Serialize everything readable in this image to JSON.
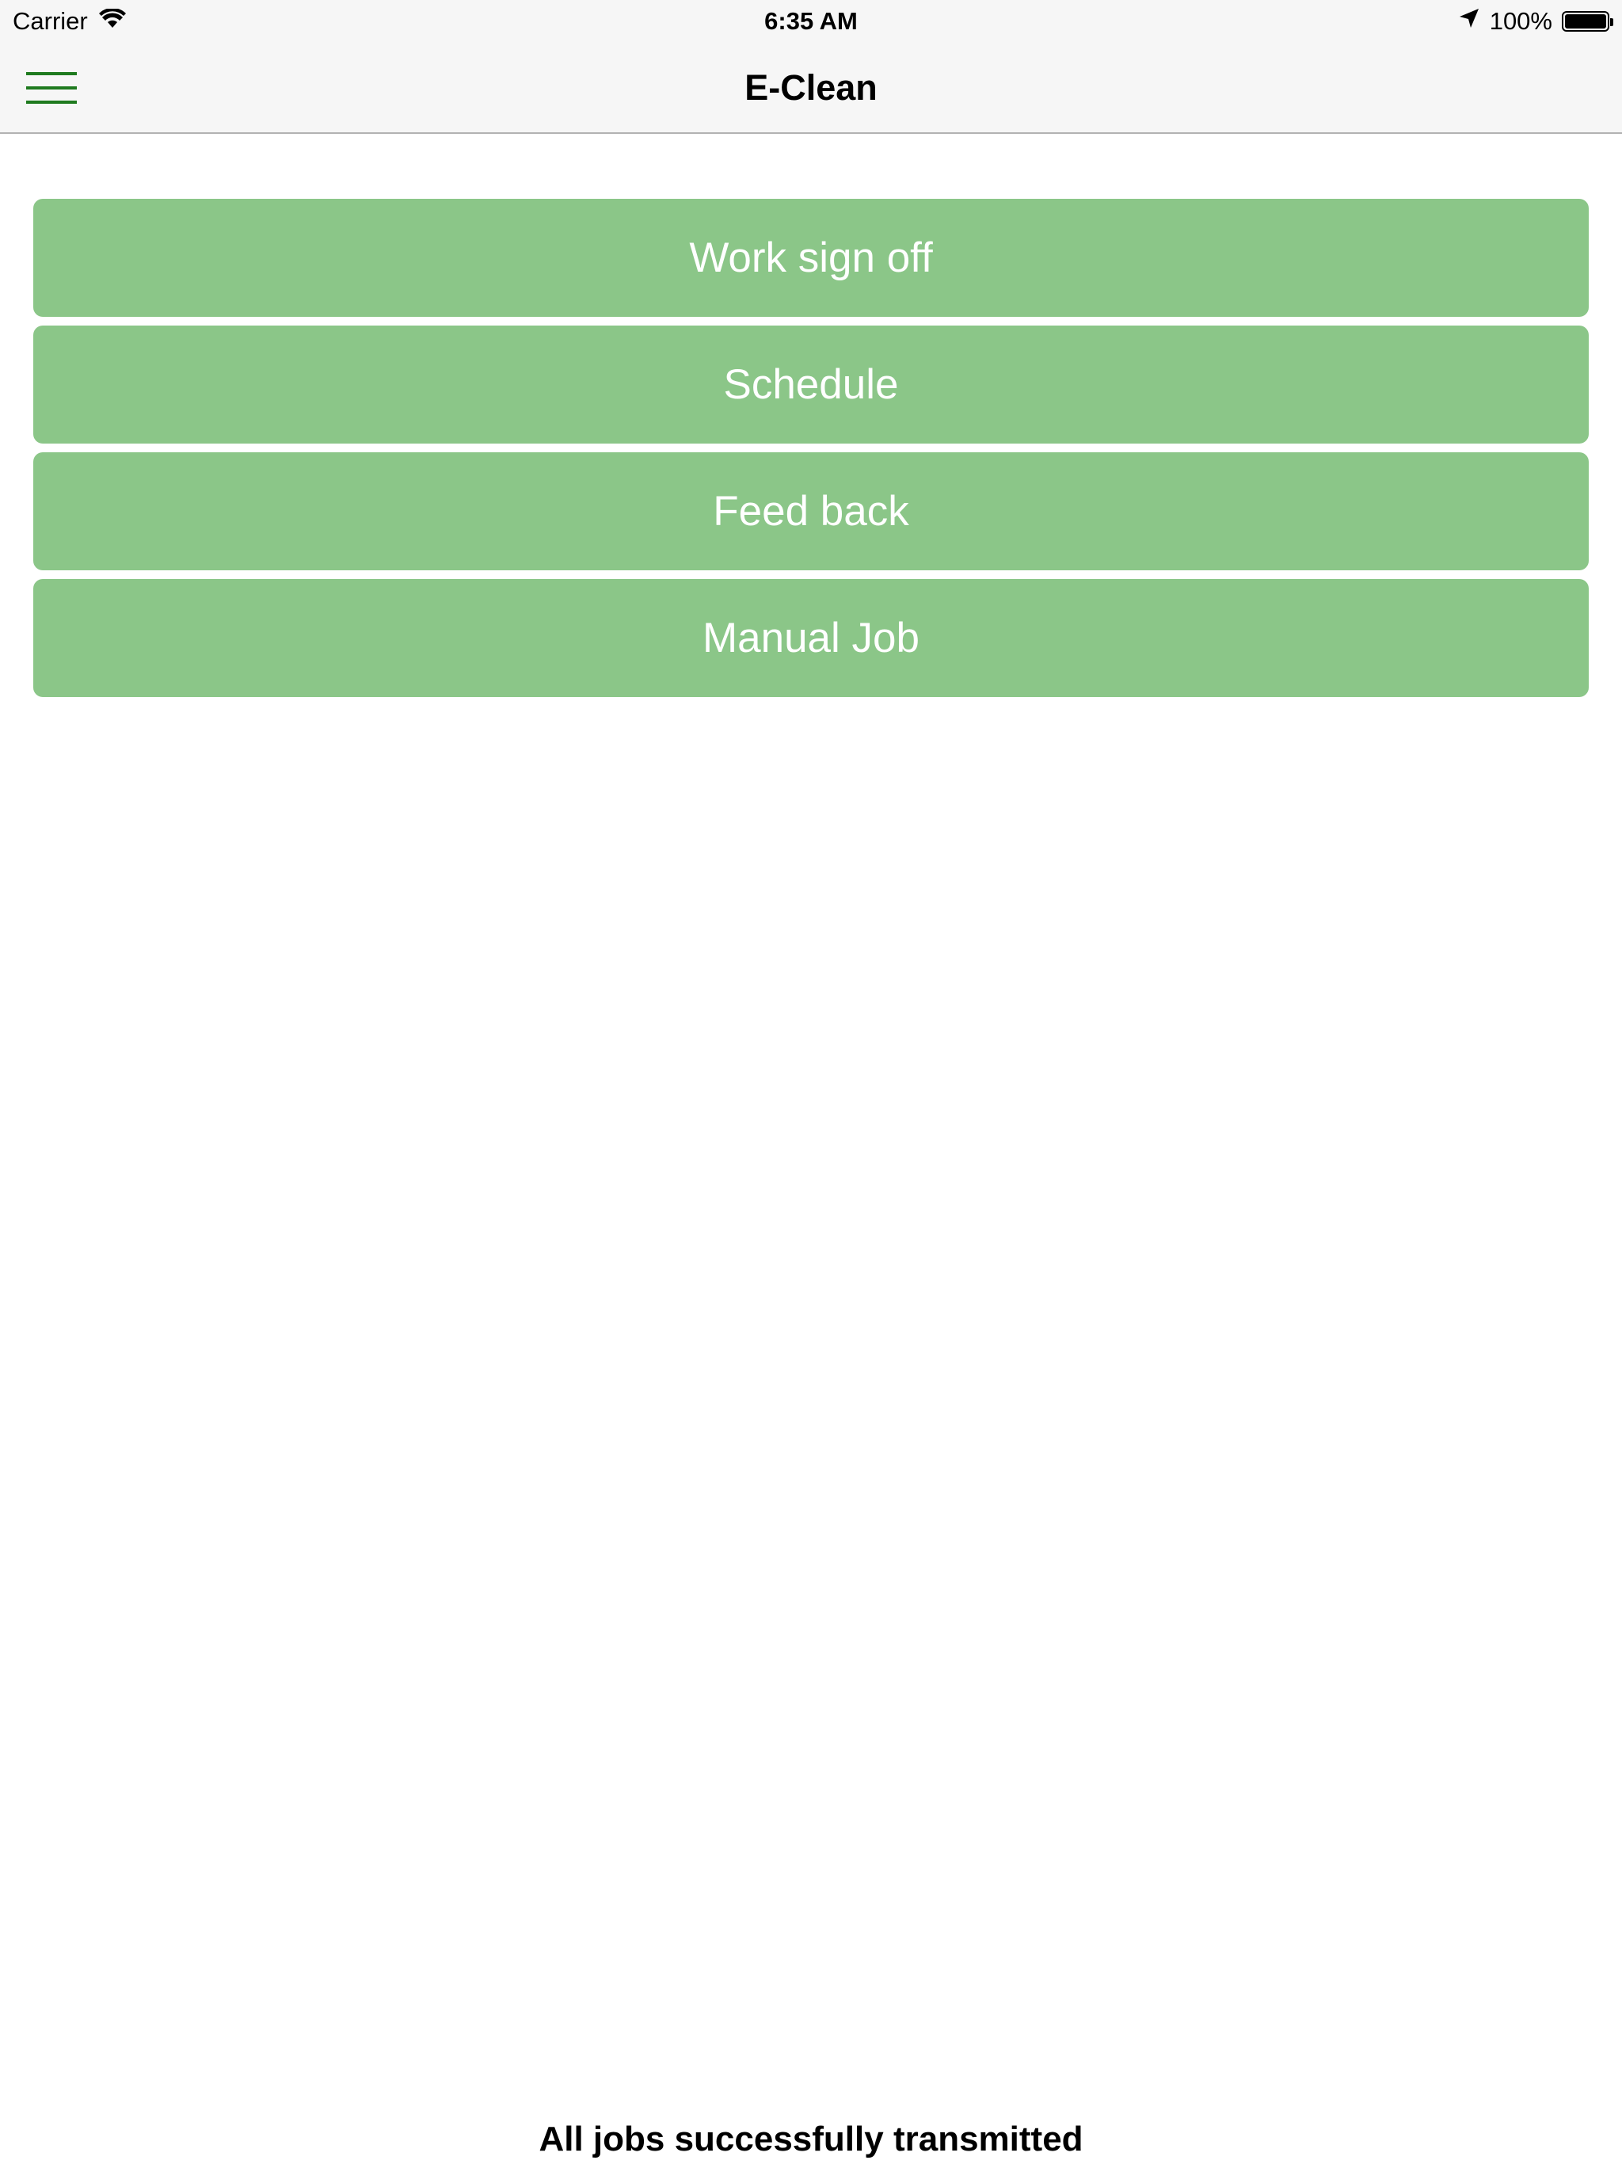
{
  "status_bar": {
    "carrier": "Carrier",
    "time": "6:35 AM",
    "battery_percent": "100%",
    "battery_level": 1.0,
    "icons": [
      "wifi-icon",
      "location-arrow-icon",
      "battery-icon"
    ]
  },
  "nav": {
    "title": "E-Clean",
    "menu_icon": "hamburger-menu-icon"
  },
  "menu": {
    "items": [
      {
        "label": "Work sign off"
      },
      {
        "label": "Schedule"
      },
      {
        "label": "Feed back"
      },
      {
        "label": "Manual Job"
      }
    ]
  },
  "footer": {
    "status_text": "All jobs successfully transmitted"
  },
  "colors": {
    "button_background": "#8bc688",
    "button_text": "#ffffff",
    "menu_icon": "#1e7a1e",
    "bar_background": "#f6f6f6"
  }
}
